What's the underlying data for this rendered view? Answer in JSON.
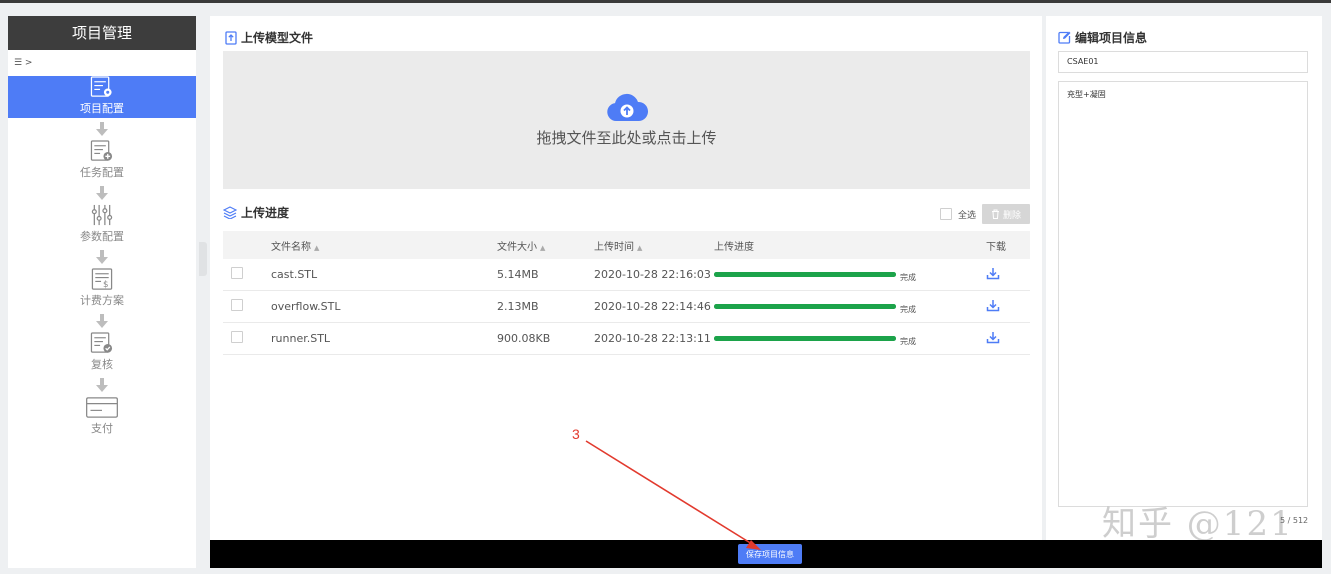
{
  "sidebar": {
    "title": "项目管理",
    "breadcrumb": "☰ >",
    "steps": [
      {
        "label": "项目配置",
        "icon": "form-gear-icon",
        "active": true
      },
      {
        "label": "任务配置",
        "icon": "form-plus-icon",
        "active": false
      },
      {
        "label": "参数配置",
        "icon": "sliders-icon",
        "active": false
      },
      {
        "label": "计费方案",
        "icon": "billing-doc-icon",
        "active": false
      },
      {
        "label": "复核",
        "icon": "form-check-icon",
        "active": false
      },
      {
        "label": "支付",
        "icon": "card-icon",
        "active": false
      }
    ]
  },
  "upload": {
    "title": "上传模型文件",
    "dropzone_text": "拖拽文件至此处或点击上传"
  },
  "progress": {
    "title": "上传进度",
    "select_all": "全选",
    "delete": "删除",
    "columns": [
      "文件名称",
      "文件大小",
      "上传时间",
      "上传进度",
      "下载"
    ],
    "rows": [
      {
        "name": "cast.STL",
        "size": "5.14MB",
        "time": "2020-10-28 22:16:03",
        "progress": 100,
        "status": "完成"
      },
      {
        "name": "overflow.STL",
        "size": "2.13MB",
        "time": "2020-10-28 22:14:46",
        "progress": 100,
        "status": "完成"
      },
      {
        "name": "runner.STL",
        "size": "900.08KB",
        "time": "2020-10-28 22:13:11",
        "progress": 100,
        "status": "完成"
      }
    ]
  },
  "edit": {
    "title": "编辑项目信息",
    "name_value": "CSAE01",
    "desc_value": "充型+凝固",
    "counter": "5 / 512"
  },
  "footer": {
    "save_label": "保存项目信息"
  },
  "annotation": {
    "number": "3"
  },
  "watermark": "知乎 @121",
  "colors": {
    "accent": "#4e7cf6",
    "progress": "#1ca34a",
    "annotation": "#e23a2e",
    "sidebar_header": "#3d3d3d"
  }
}
